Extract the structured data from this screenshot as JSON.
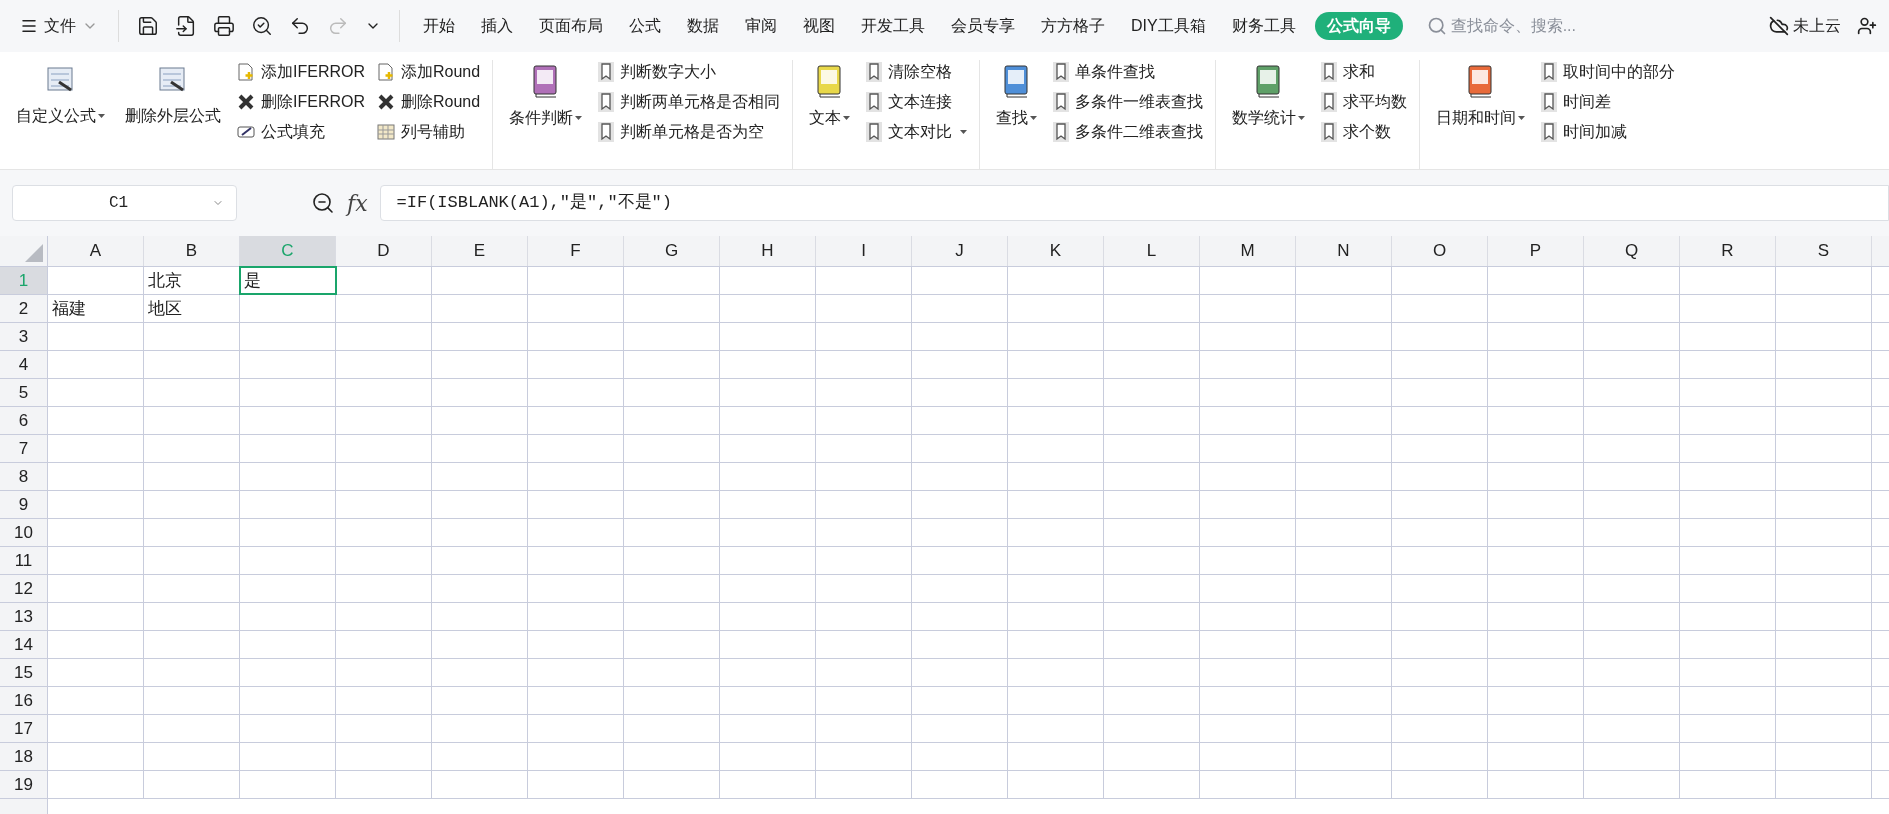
{
  "menu": {
    "label": "文件"
  },
  "tabs": [
    {
      "label": "开始",
      "selected": false
    },
    {
      "label": "插入",
      "selected": false
    },
    {
      "label": "页面布局",
      "selected": false
    },
    {
      "label": "公式",
      "selected": false
    },
    {
      "label": "数据",
      "selected": false
    },
    {
      "label": "审阅",
      "selected": false
    },
    {
      "label": "视图",
      "selected": false
    },
    {
      "label": "开发工具",
      "selected": false
    },
    {
      "label": "会员专享",
      "selected": false
    },
    {
      "label": "方方格子",
      "selected": false
    },
    {
      "label": "DIY工具箱",
      "selected": false
    },
    {
      "label": "财务工具",
      "selected": false
    },
    {
      "label": "公式向导",
      "selected": true
    }
  ],
  "search": {
    "placeholder": "查找命令、搜索..."
  },
  "cloud": {
    "label": "未上云"
  },
  "ribbon": [
    {
      "large": [
        {
          "label": "自定义公式",
          "dropdown": true
        },
        {
          "label": "删除外层公式",
          "dropdown": false
        }
      ],
      "columns": [
        [
          {
            "label": "添加IFERROR",
            "dropdown": false
          },
          {
            "label": "删除IFERROR",
            "dropdown": false
          },
          {
            "label": "公式填充",
            "dropdown": false
          }
        ],
        [
          {
            "label": "添加Round",
            "dropdown": false
          },
          {
            "label": "删除Round",
            "dropdown": false
          },
          {
            "label": "列号辅助",
            "dropdown": false
          }
        ]
      ]
    },
    {
      "large": [
        {
          "label": "条件判断",
          "dropdown": true
        }
      ],
      "columns": [
        [
          {
            "label": "判断数字大小",
            "dropdown": false
          },
          {
            "label": "判断两单元格是否相同",
            "dropdown": false
          },
          {
            "label": "判断单元格是否为空",
            "dropdown": false
          }
        ]
      ]
    },
    {
      "large": [
        {
          "label": "文本",
          "dropdown": true
        }
      ],
      "columns": [
        [
          {
            "label": "清除空格",
            "dropdown": false
          },
          {
            "label": "文本连接",
            "dropdown": false
          },
          {
            "label": "文本对比",
            "dropdown": true
          }
        ]
      ]
    },
    {
      "large": [
        {
          "label": "查找",
          "dropdown": true
        }
      ],
      "columns": [
        [
          {
            "label": "单条件查找",
            "dropdown": false
          },
          {
            "label": "多条件一维表查找",
            "dropdown": false
          },
          {
            "label": "多条件二维表查找",
            "dropdown": false
          }
        ]
      ]
    },
    {
      "large": [
        {
          "label": "数学统计",
          "dropdown": true
        }
      ],
      "columns": [
        [
          {
            "label": "求和",
            "dropdown": false
          },
          {
            "label": "求平均数",
            "dropdown": false
          },
          {
            "label": "求个数",
            "dropdown": false
          }
        ]
      ]
    },
    {
      "large": [
        {
          "label": "日期和时间",
          "dropdown": true
        }
      ],
      "columns": [
        [
          {
            "label": "取时间中的部分",
            "dropdown": false
          },
          {
            "label": "时间差",
            "dropdown": false
          },
          {
            "label": "时间加减",
            "dropdown": false
          }
        ]
      ]
    }
  ],
  "name_box": {
    "value": "C1"
  },
  "formula": {
    "fx": "fx",
    "value": "=IF(ISBLANK(A1),\"是\",\"不是\")"
  },
  "columns": [
    {
      "label": "A",
      "selected": false
    },
    {
      "label": "B",
      "selected": false
    },
    {
      "label": "C",
      "selected": true
    },
    {
      "label": "D",
      "selected": false
    },
    {
      "label": "E",
      "selected": false
    },
    {
      "label": "F",
      "selected": false
    },
    {
      "label": "G",
      "selected": false
    },
    {
      "label": "H",
      "selected": false
    },
    {
      "label": "I",
      "selected": false
    },
    {
      "label": "J",
      "selected": false
    },
    {
      "label": "K",
      "selected": false
    },
    {
      "label": "L",
      "selected": false
    },
    {
      "label": "M",
      "selected": false
    },
    {
      "label": "N",
      "selected": false
    },
    {
      "label": "O",
      "selected": false
    },
    {
      "label": "P",
      "selected": false
    },
    {
      "label": "Q",
      "selected": false
    },
    {
      "label": "R",
      "selected": false
    },
    {
      "label": "S",
      "selected": false
    }
  ],
  "rows": [
    {
      "label": "1",
      "selected": true,
      "cells": {
        "B": {
          "value": "北京",
          "active": false
        },
        "C": {
          "value": "是",
          "active": true
        }
      }
    },
    {
      "label": "2",
      "selected": false,
      "cells": {
        "A": {
          "value": "福建",
          "active": false
        },
        "B": {
          "value": "地区",
          "active": false
        }
      }
    },
    {
      "label": "3",
      "selected": false
    },
    {
      "label": "4",
      "selected": false
    },
    {
      "label": "5",
      "selected": false
    },
    {
      "label": "6",
      "selected": false
    },
    {
      "label": "7",
      "selected": false
    },
    {
      "label": "8",
      "selected": false
    },
    {
      "label": "9",
      "selected": false
    },
    {
      "label": "10",
      "selected": false
    },
    {
      "label": "11",
      "selected": false
    },
    {
      "label": "12",
      "selected": false
    },
    {
      "label": "13",
      "selected": false
    },
    {
      "label": "14",
      "selected": false
    },
    {
      "label": "15",
      "selected": false
    },
    {
      "label": "16",
      "selected": false
    },
    {
      "label": "17",
      "selected": false
    },
    {
      "label": "18",
      "selected": false
    },
    {
      "label": "19",
      "selected": false
    }
  ]
}
